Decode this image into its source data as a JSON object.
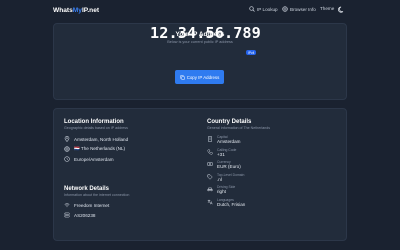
{
  "header": {
    "brand_part1": "Whats",
    "brand_part2": "My",
    "brand_part3": "IP.net",
    "nav": {
      "ip_lookup": "IP Lookup",
      "browser_info": "Browser Info",
      "theme": "Theme"
    }
  },
  "ip_card": {
    "title": "Your IP Address",
    "subtitle": "Below is your current public IP address",
    "ip": "12.34.56.789",
    "version_badge": "IPv4",
    "copy_label": "Copy IP Address"
  },
  "location": {
    "title": "Location Information",
    "subtitle": "Geographic details based on IP address",
    "city": "Amsterdam, North Holland",
    "country": "🇳🇱 The Netherlands (NL)",
    "timezone": "Europe/Amsterdam"
  },
  "network": {
    "title": "Network Details",
    "subtitle": "Information about the internet connection",
    "isp": "Freedom Internet",
    "asn": "AS206238"
  },
  "country": {
    "title": "Country Details",
    "subtitle": "General information of The Netherlands",
    "items": [
      {
        "label": "Capital",
        "value": "Amsterdam",
        "icon": "building-icon"
      },
      {
        "label": "Calling Code",
        "value": "+31",
        "icon": "phone-icon"
      },
      {
        "label": "Currency",
        "value": "EUR (Euro)",
        "icon": "currency-icon"
      },
      {
        "label": "Top-Level Domain",
        "value": ".nl",
        "icon": "tag-icon"
      },
      {
        "label": "Driving Side",
        "value": "right",
        "icon": "car-icon"
      },
      {
        "label": "Languages",
        "value": "Dutch, Frisian",
        "icon": "languages-icon"
      }
    ]
  },
  "colors": {
    "background": "#1a2230",
    "card": "#222c3b",
    "accent": "#2f7bf0",
    "brand_highlight": "#3b82f6"
  }
}
